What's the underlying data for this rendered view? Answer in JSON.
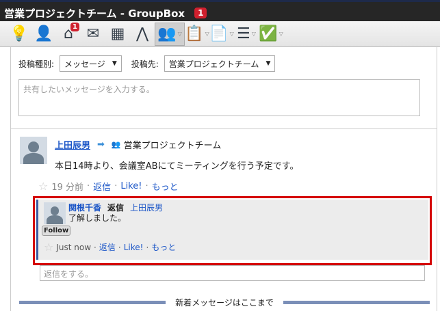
{
  "window": {
    "title": "営業プロジェクトチーム - GroupBox",
    "badge": "1"
  },
  "toolbar": {
    "items": [
      {
        "icon": "lightbulb-icon",
        "glyph": "💡"
      },
      {
        "icon": "user-icon",
        "glyph": "👤"
      },
      {
        "icon": "home-cube-icon",
        "glyph": "⌂",
        "badge": "1"
      },
      {
        "icon": "mail-icon",
        "glyph": "✉"
      },
      {
        "icon": "building-icon",
        "glyph": "▦"
      },
      {
        "icon": "compass-icon",
        "glyph": "⋀"
      },
      {
        "icon": "group-icon",
        "glyph": "👥",
        "dropdown": "▽",
        "selected": true
      },
      {
        "icon": "clipboard-user-icon",
        "glyph": "📋",
        "dropdown": "▽"
      },
      {
        "icon": "document-pin-icon",
        "glyph": "📄",
        "dropdown": "▽"
      },
      {
        "icon": "list-icon",
        "glyph": "☰",
        "dropdown": "▽"
      },
      {
        "icon": "checkbox-icon",
        "glyph": "✅",
        "dropdown": "▽"
      }
    ]
  },
  "form": {
    "type_label": "投稿種別:",
    "type_value": "メッセージ",
    "dest_label": "投稿先:",
    "dest_value": "営業プロジェクトチーム",
    "caret": "▼",
    "placeholder": "共有したいメッセージを入力する。"
  },
  "post": {
    "author": "上田辰男",
    "arrow": "➡",
    "group": "営業プロジェクトチーム",
    "body": "本日14時より、会議室ABにてミーティングを行う予定です。",
    "time": "19 分前",
    "reply": "返信",
    "like": "Like!",
    "more": "もっと",
    "sep": "·"
  },
  "reply": {
    "author": "関根千香",
    "action": "返信",
    "target": "上田辰男",
    "body": "了解しました。",
    "follow": "Follow",
    "time": "Just now",
    "reply": "返信",
    "like": "Like!",
    "more": "もっと"
  },
  "reply_placeholder": "返信をする。",
  "new_marker": "新着メッセージはここまで"
}
